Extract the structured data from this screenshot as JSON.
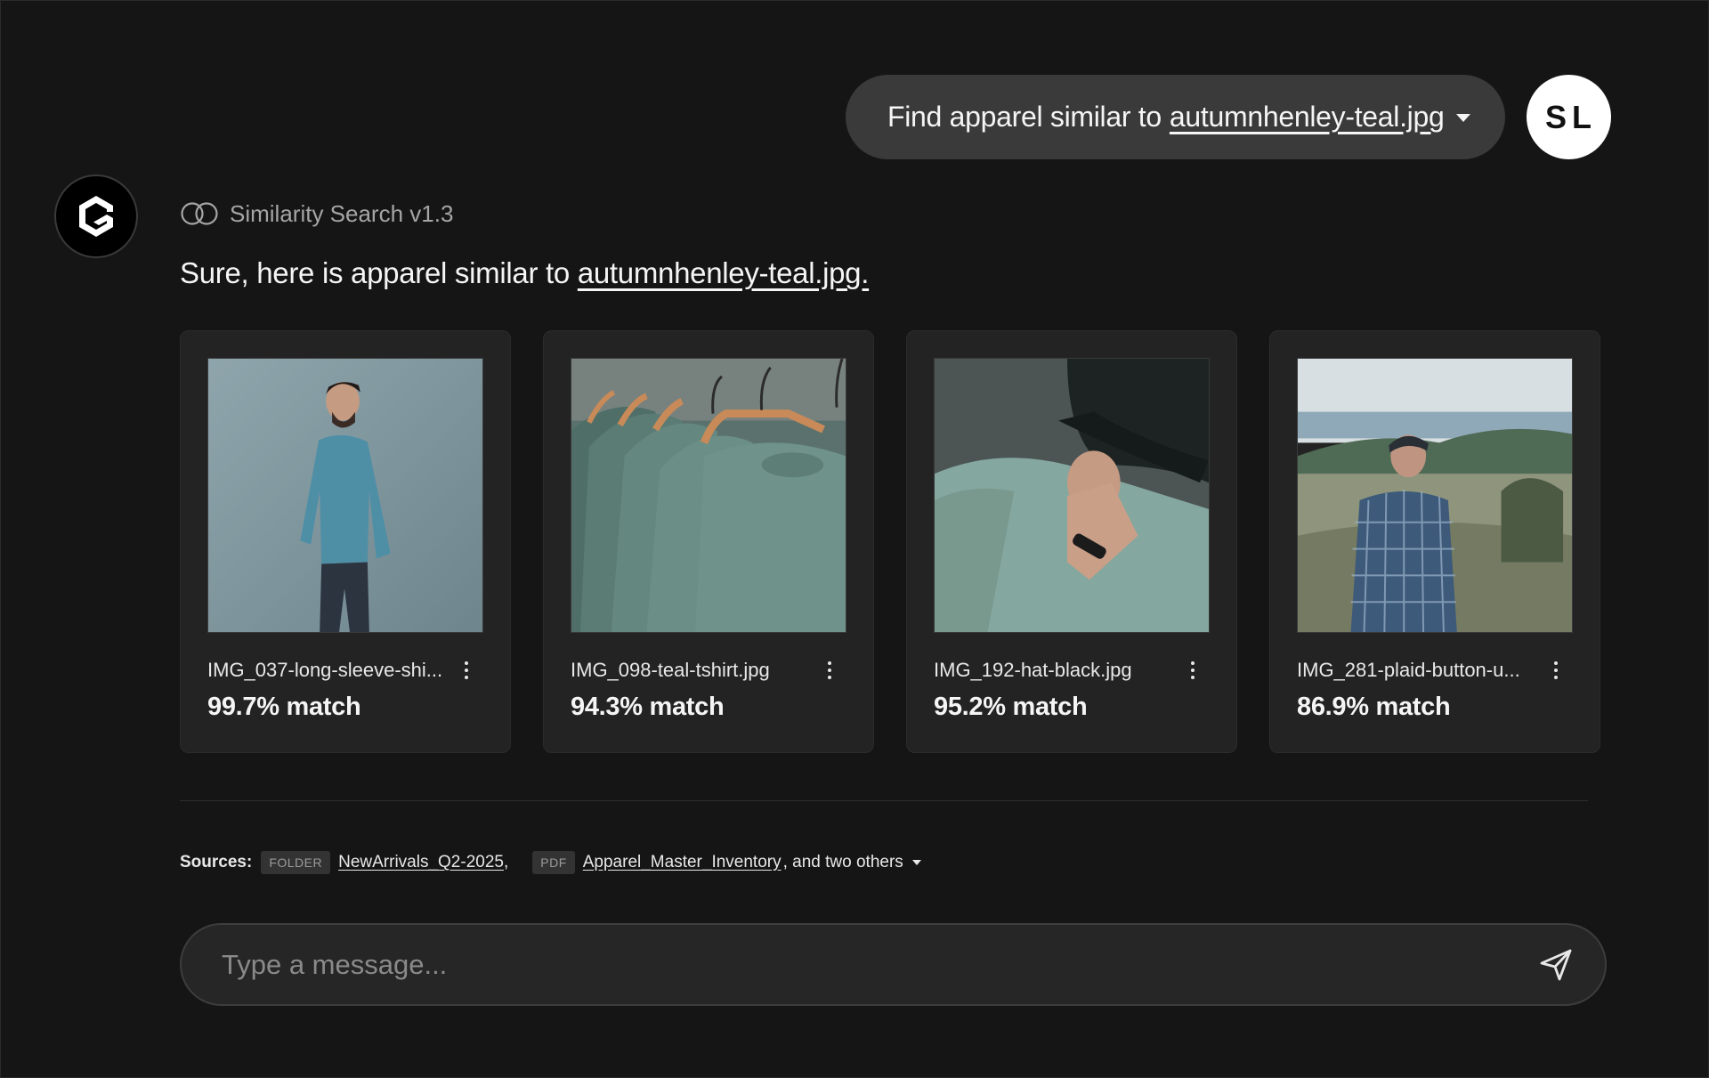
{
  "user_message": {
    "prefix": "Find apparel similar to",
    "file": "autumnhenley-teal.jpg",
    "caret_icon": "caret-down-icon",
    "avatar_initials": "SL"
  },
  "assistant": {
    "logo_icon": "hexagon-logo-icon",
    "model_icon": "overlapping-circles-icon",
    "model_name": "Similarity Search v1.3",
    "reply_prefix": "Sure, here is apparel similar to",
    "reply_file": "autumnhenley-teal.jpg."
  },
  "results": [
    {
      "filename": "IMG_037-long-sleeve-shi...",
      "match": "99.7% match",
      "image": "man in teal long-sleeve shirt"
    },
    {
      "filename": "IMG_098-teal-tshirt.jpg",
      "match": "94.3% match",
      "image": "teal t-shirts on wooden hangers"
    },
    {
      "filename": "IMG_192-hat-black.jpg",
      "match": "95.2% match",
      "image": "man in teal tee holding black cap"
    },
    {
      "filename": "IMG_281-plaid-button-u...",
      "match": "86.9% match",
      "image": "man in blue plaid shirt in field"
    }
  ],
  "sources": {
    "label": "Sources:",
    "items": [
      {
        "tag": "FOLDER",
        "name": "NewArrivals_Q2-2025"
      },
      {
        "tag": "PDF",
        "name": "Apparel_Master_Inventory"
      }
    ],
    "others_text": ", and two others"
  },
  "composer": {
    "placeholder": "Type a message...",
    "send_icon": "send-icon"
  },
  "colors": {
    "background": "#151515",
    "card": "#232323",
    "bubble": "#3a3a3a",
    "teal": "#5f8a86"
  }
}
